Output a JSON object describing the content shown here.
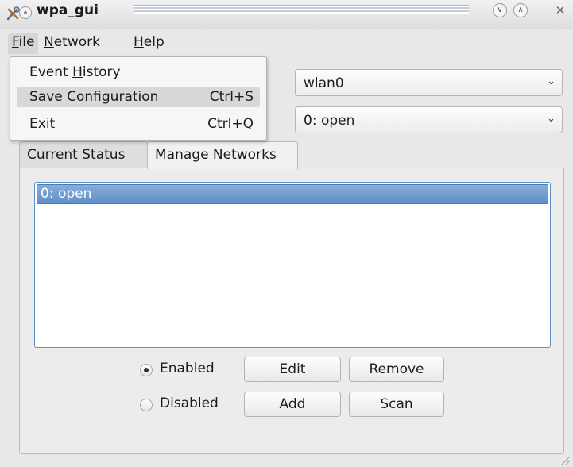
{
  "window": {
    "title": "wpa_gui",
    "icons": {
      "app": "tools-icon",
      "minimize": "chevron-down-icon",
      "maximize": "chevron-up-icon",
      "close": "close-icon"
    }
  },
  "menubar": {
    "file": {
      "first": "F",
      "rest": "ile"
    },
    "network": {
      "first": "N",
      "rest": "etwork"
    },
    "help": {
      "first": "H",
      "rest": "elp"
    }
  },
  "file_menu": {
    "items": [
      {
        "pre": "Event ",
        "mnemonic": "H",
        "post": "istory",
        "shortcut": ""
      },
      {
        "pre": "",
        "mnemonic": "S",
        "post": "ave Configuration",
        "shortcut": "Ctrl+S"
      },
      {
        "pre": "E",
        "mnemonic": "x",
        "post": "it",
        "shortcut": "Ctrl+Q"
      }
    ]
  },
  "adapter": {
    "selected": "wlan0"
  },
  "network": {
    "selected": "0: open"
  },
  "tabs": [
    {
      "label": "Current Status"
    },
    {
      "label": "Manage Networks"
    }
  ],
  "manage": {
    "networks": [
      "0: open"
    ],
    "radio_enabled": "Enabled",
    "radio_disabled": "Disabled",
    "edit": "Edit",
    "remove": "Remove",
    "add": "Add",
    "scan": "Scan"
  },
  "colors": {
    "selection": "#5f8fc8",
    "background": "#e8e8e8"
  }
}
